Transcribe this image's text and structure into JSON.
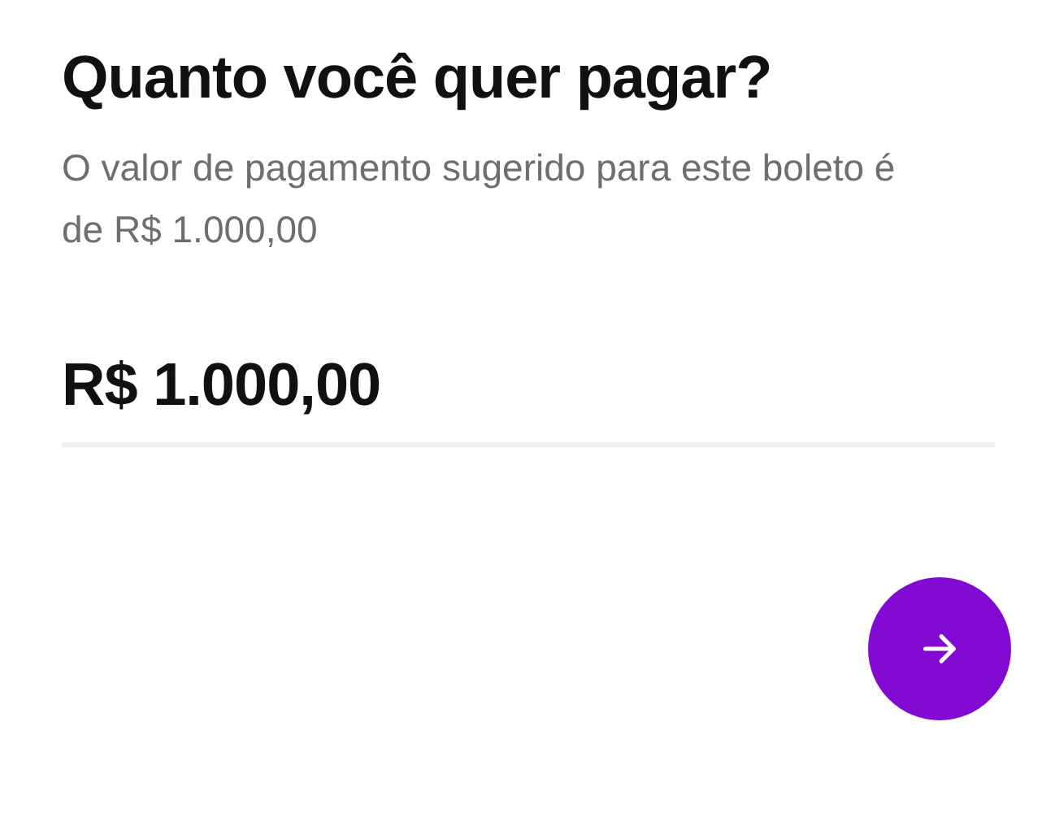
{
  "title": "Quanto você quer pagar?",
  "description": "O valor de pagamento sugerido para este boleto é de R$ 1.000,00",
  "amount_field": {
    "value": "R$ 1.000,00"
  },
  "next_button": {
    "disabled": false
  }
}
